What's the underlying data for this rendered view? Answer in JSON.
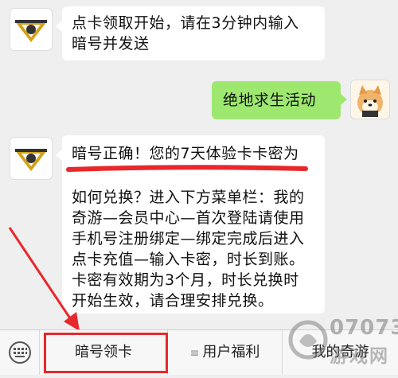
{
  "messages": [
    {
      "side": "left",
      "lines": [
        "点卡领取开始，请在3分钟内输入",
        "暗号并发送"
      ]
    },
    {
      "side": "right",
      "lines": [
        "绝地求生活动"
      ]
    },
    {
      "side": "left",
      "lines": [
        "暗号正确！您的7天体验卡卡密为",
        "",
        "如何兑换？进入下方菜单栏：我的",
        "奇游—会员中心—首次登陆请使用",
        "手机号注册绑定—绑定完成后进入",
        "点卡充值—输入卡密，时长到账。",
        "卡密有效期为3个月，时长兑换时",
        "开始生效，请合理安排兑换。"
      ]
    }
  ],
  "menu": {
    "items": [
      "暗号领卡",
      "用户福利",
      "我的奇游"
    ],
    "bullet": "≡"
  },
  "watermark": {
    "line1": "07073",
    "line2": "游戏网"
  },
  "colors": {
    "accent_red": "#e8282b",
    "bubble_green": "#9ee870",
    "logo_gold": "#d4a017"
  }
}
